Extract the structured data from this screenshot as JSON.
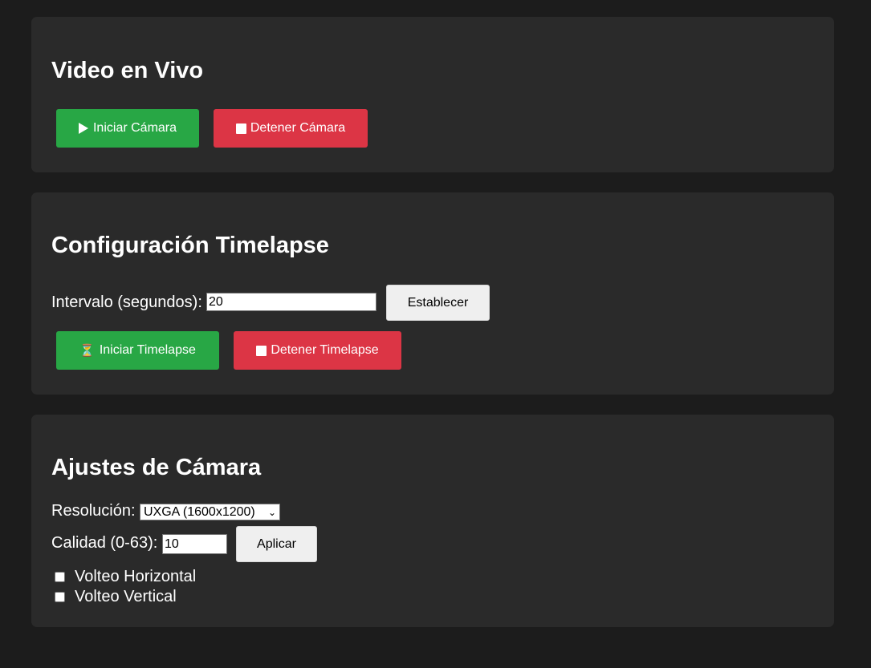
{
  "video_section": {
    "title": "Video en Vivo",
    "start_label": "Iniciar Cámara",
    "stop_label": "Detener Cámara"
  },
  "timelapse_section": {
    "title": "Configuración Timelapse",
    "interval_label": "Intervalo (segundos):",
    "interval_value": "20",
    "set_label": "Establecer",
    "start_icon": "⏳",
    "start_label": "Iniciar Timelapse",
    "stop_label": "Detener Timelapse"
  },
  "settings_section": {
    "title": "Ajustes de Cámara",
    "resolution_label": "Resolución:",
    "resolution_value": "UXGA (1600x1200)",
    "quality_label": "Calidad (0-63):",
    "quality_value": "10",
    "apply_label": "Aplicar",
    "hflip_label": "Volteo Horizontal",
    "vflip_label": "Volteo Vertical"
  },
  "colors": {
    "page_bg": "#1c1c1c",
    "card_bg": "#2a2a2a",
    "green": "#28a745",
    "red": "#dc3545"
  },
  "icons": {
    "play": "play-icon",
    "stop": "stop-icon",
    "hourglass": "hourglass-icon",
    "chevron": "chevron-down-icon"
  }
}
